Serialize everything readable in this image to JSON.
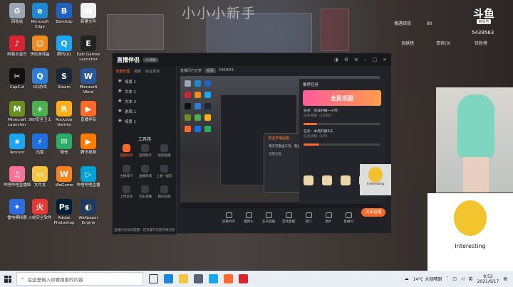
{
  "stream": {
    "title": "小小小新手",
    "platform_logo": "斗鱼",
    "platform_sub": "房间号",
    "room_id": "5439563",
    "hud_name": "偶遇暗夜",
    "hud_count": "80",
    "hud_stats": [
      "贡献榜",
      "贵宾(0)",
      "铁粉榜"
    ]
  },
  "desktop_icons": [
    {
      "label": "回收站",
      "color": "#9aa6b2",
      "glyph": "♻"
    },
    {
      "label": "Microsoft Edge",
      "color": "#1e88d6",
      "glyph": "e"
    },
    {
      "label": "Bandizip",
      "color": "#2062c4",
      "glyph": "B"
    },
    {
      "label": "新建文件",
      "color": "#f0f0f0",
      "glyph": "W"
    },
    {
      "label": "网易云音乐",
      "color": "#d9232e",
      "glyph": "♪"
    },
    {
      "label": "快玩游戏盒",
      "color": "#f08a1c",
      "glyph": "☺"
    },
    {
      "label": "腾讯QQ",
      "color": "#1aa6f0",
      "glyph": "Q"
    },
    {
      "label": "Epic Games Launcher",
      "color": "#222222",
      "glyph": "E"
    },
    {
      "label": "CapCut",
      "color": "#111111",
      "glyph": "✂"
    },
    {
      "label": "QQ游戏",
      "color": "#2c7fd8",
      "glyph": "Q"
    },
    {
      "label": "Steam",
      "color": "#1b2838",
      "glyph": "S"
    },
    {
      "label": "Microsoft Word",
      "color": "#2b579a",
      "glyph": "W"
    },
    {
      "label": "Minecraft Launcher",
      "color": "#6b8e23",
      "glyph": "M"
    },
    {
      "label": "360安全卫士",
      "color": "#4caf50",
      "glyph": "+"
    },
    {
      "label": "Rockstar Games",
      "color": "#fcaf17",
      "glyph": "R"
    },
    {
      "label": "直播伴侣",
      "color": "#ff6a2b",
      "glyph": "▶"
    },
    {
      "label": "Tencent",
      "color": "#1aa6f0",
      "glyph": "★"
    },
    {
      "label": "迅雷",
      "color": "#1e6fe0",
      "glyph": "⚡"
    },
    {
      "label": "微信",
      "color": "#2aae67",
      "glyph": "✉"
    },
    {
      "label": "腾讯视频",
      "color": "#ff7a00",
      "glyph": "▶"
    },
    {
      "label": "哔哩哔哩直播姬",
      "color": "#fb7299",
      "glyph": "♫"
    },
    {
      "label": "文件夹",
      "color": "#f4c542",
      "glyph": "▭"
    },
    {
      "label": "WeGame",
      "color": "#f58220",
      "glyph": "W"
    },
    {
      "label": "哔哩哔哩直播",
      "color": "#00a1d6",
      "glyph": "▷"
    },
    {
      "label": "雷电模拟器",
      "color": "#2d6cdf",
      "glyph": "✦"
    },
    {
      "label": "火绒安全软件",
      "color": "#e53935",
      "glyph": "火"
    },
    {
      "label": "Adobe Photoshop",
      "color": "#001e36",
      "glyph": "Ps"
    },
    {
      "label": "Wallpaper Engine",
      "color": "#1f3a5f",
      "glyph": "◐"
    }
  ],
  "app": {
    "brand": "直播伴侣",
    "version": "公测版",
    "left_tabs": [
      "场景管理",
      "视频",
      "综合素材"
    ],
    "scenes": [
      "场景 1",
      "文本 1",
      "文本 2",
      "游戏 1",
      "场景 1"
    ],
    "toolbox_title": "工具箱",
    "tools": [
      "直播助手",
      "运营助手",
      "视频直播",
      "主播排行",
      "直播商城",
      "上麦一起玩",
      "上传高亮",
      "音乐直播",
      "精彩回放"
    ],
    "left_bottom": "直播间违禁词提醒！若未遵守可能导致封禁",
    "center_bar": [
      "直播间已正常",
      "观看",
      "240/643"
    ],
    "dialog": {
      "header": "发送开播提醒",
      "body": "每天可发送三次，粉丝将收到开播提醒！",
      "link": "提醒设置",
      "button": "发送开播提醒"
    },
    "bottom_tools": [
      "屏幕共享",
      "摄像头",
      "多开直播",
      "游戏直播",
      "窗口",
      "图片",
      "直播间"
    ],
    "go_live": "关闭直播",
    "right_title": "推荐任务",
    "banner": "全民乐园",
    "tasks": [
      {
        "title": "任务：完成开播一小时",
        "sub": "任务奖励（10/60）",
        "progress": 0.18
      },
      {
        "title": "任务：本周开播5天",
        "sub": "任务奖励（1/5）",
        "progress": 0.2
      }
    ]
  },
  "chat_caption": "Interesting",
  "meme_caption": "Interesting",
  "taskbar": {
    "search_placeholder": "在这里输入你要搜索的内容",
    "weather": "14°C  大部晴朗",
    "ime": "英",
    "time": "8:52",
    "date": "2021/6/17"
  }
}
